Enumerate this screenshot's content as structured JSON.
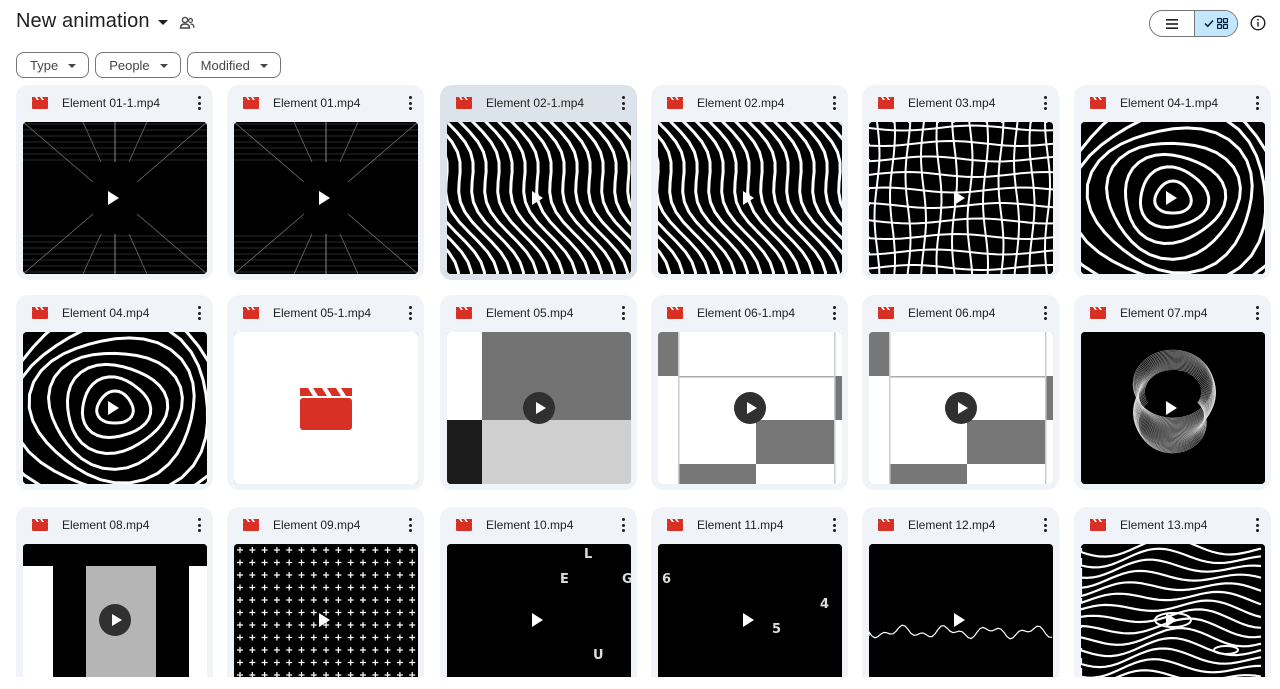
{
  "header": {
    "title": "New animation",
    "share_icon": "shared-people-icon",
    "view_list_icon": "list-view-icon",
    "view_grid_icon": "grid-view-icon",
    "info_icon": "info-icon"
  },
  "filters": [
    {
      "label": "Type"
    },
    {
      "label": "People"
    },
    {
      "label": "Modified"
    }
  ],
  "colors": {
    "file_icon": "#d93025",
    "card_bg": "#f0f4f9",
    "card_selected_bg": "#dde3ea",
    "toggle_active": "#c2e7ff"
  },
  "files": [
    {
      "name": "Element 01-1.mp4"
    },
    {
      "name": "Element 01.mp4"
    },
    {
      "name": "Element 02-1.mp4",
      "selected": true
    },
    {
      "name": "Element 02.mp4"
    },
    {
      "name": "Element 03.mp4"
    },
    {
      "name": "Element 04-1.mp4"
    },
    {
      "name": "Element 04.mp4"
    },
    {
      "name": "Element 05-1.mp4"
    },
    {
      "name": "Element 05.mp4"
    },
    {
      "name": "Element 06-1.mp4"
    },
    {
      "name": "Element 06.mp4"
    },
    {
      "name": "Element 07.mp4"
    },
    {
      "name": "Element 08.mp4"
    },
    {
      "name": "Element 09.mp4"
    },
    {
      "name": "Element 10.mp4",
      "letters": [
        "L",
        "E",
        "G",
        "U"
      ]
    },
    {
      "name": "Element 11.mp4",
      "letters": [
        "6",
        "4",
        "5"
      ]
    },
    {
      "name": "Element 12.mp4"
    },
    {
      "name": "Element 13.mp4"
    }
  ]
}
